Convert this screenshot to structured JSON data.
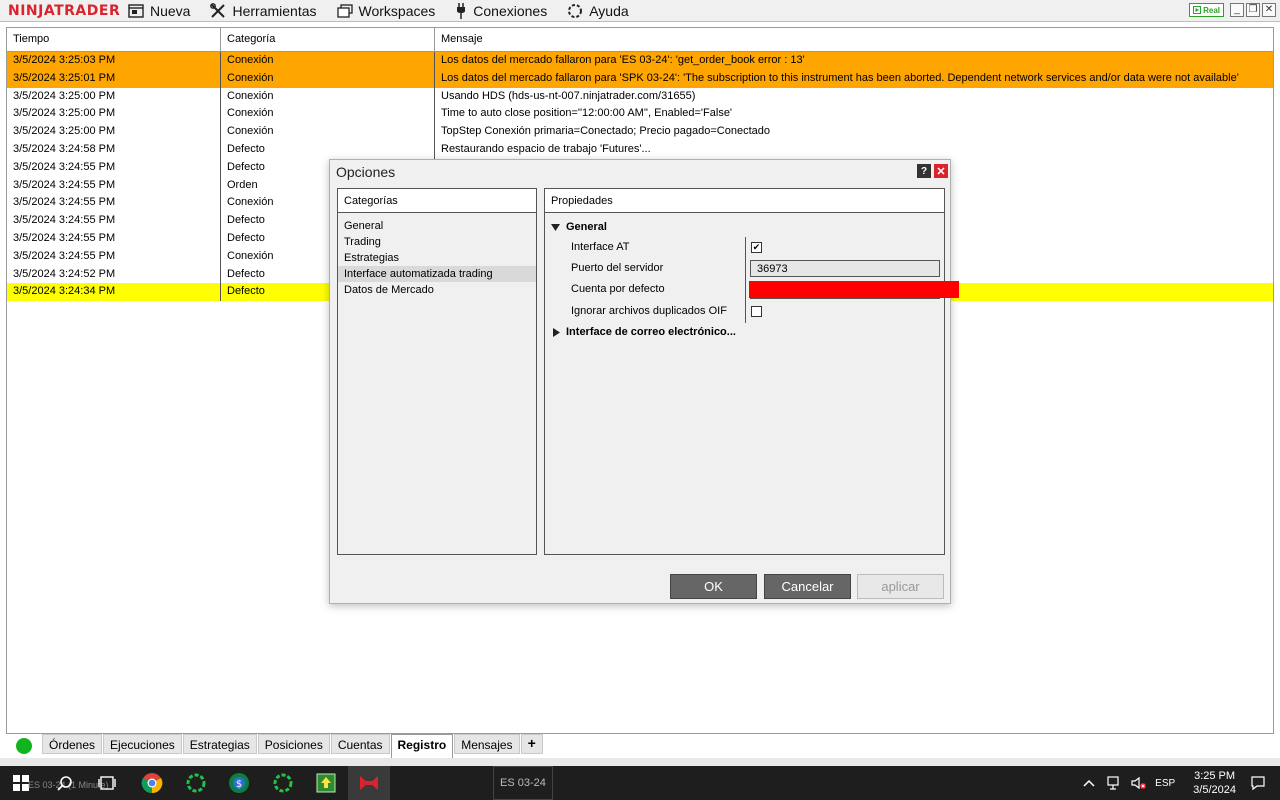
{
  "app": {
    "logo": "NINJATRADER",
    "menu": [
      {
        "label": "Nueva",
        "icon": "document-icon"
      },
      {
        "label": "Herramientas",
        "icon": "tools-icon"
      },
      {
        "label": "Workspaces",
        "icon": "windows-icon"
      },
      {
        "label": "Conexiones",
        "icon": "plug-icon"
      },
      {
        "label": "Ayuda",
        "icon": "help-ring-icon"
      }
    ],
    "badge": "Real",
    "accent_color": "#d9232d"
  },
  "log": {
    "columns": [
      "Tiempo",
      "Categoría",
      "Mensaje"
    ],
    "rows": [
      {
        "time": "3/5/2024 3:25:03 PM",
        "category": "Conexión",
        "message": "Los datos del mercado fallaron para 'ES 03-24': 'get_order_book error : 13'",
        "highlight": "orange"
      },
      {
        "time": "3/5/2024 3:25:01 PM",
        "category": "Conexión",
        "message": "Los datos del mercado fallaron para 'SPK 03-24': 'The subscription to this instrument has been aborted.  Dependent network services and/or data were not available'",
        "highlight": "orange"
      },
      {
        "time": "3/5/2024 3:25:00 PM",
        "category": "Conexión",
        "message": "Usando HDS (hds-us-nt-007.ninjatrader.com/31655)",
        "highlight": ""
      },
      {
        "time": "3/5/2024 3:25:00 PM",
        "category": "Conexión",
        "message": "Time to auto close position=''12:00:00 AM'', Enabled='False'",
        "highlight": ""
      },
      {
        "time": "3/5/2024 3:25:00 PM",
        "category": "Conexión",
        "message": "TopStep Conexión primaria=Conectado; Precio pagado=Conectado",
        "highlight": ""
      },
      {
        "time": "3/5/2024 3:24:58 PM",
        "category": "Defecto",
        "message": "Restaurando espacio de trabajo 'Futures'...",
        "highlight": ""
      },
      {
        "time": "3/5/2024 3:24:55 PM",
        "category": "Defecto",
        "message": "",
        "highlight": ""
      },
      {
        "time": "3/5/2024 3:24:55 PM",
        "category": "Orden",
        "message": "",
        "highlight": ""
      },
      {
        "time": "3/5/2024 3:24:55 PM",
        "category": "Conexión",
        "message": "",
        "highlight": ""
      },
      {
        "time": "3/5/2024 3:24:55 PM",
        "category": "Defecto",
        "message": "",
        "highlight": ""
      },
      {
        "time": "3/5/2024 3:24:55 PM",
        "category": "Defecto",
        "message": "",
        "highlight": ""
      },
      {
        "time": "3/5/2024 3:24:55 PM",
        "category": "Conexión",
        "message": "",
        "highlight": ""
      },
      {
        "time": "3/5/2024 3:24:52 PM",
        "category": "Defecto",
        "message": "",
        "highlight": ""
      },
      {
        "time": "3/5/2024 3:24:34 PM",
        "category": "Defecto",
        "message": "",
        "highlight": "yellow"
      }
    ]
  },
  "tabs": {
    "items": [
      "Órdenes",
      "Ejecuciones",
      "Estrategias",
      "Posiciones",
      "Cuentas",
      "Registro",
      "Mensajes"
    ],
    "active": "Registro",
    "add": "+"
  },
  "dialog": {
    "title": "Opciones",
    "help": "?",
    "close": "✕",
    "categories_header": "Categorías",
    "categories": [
      "General",
      "Trading",
      "Estrategias",
      "Interface automatizada trading",
      "Datos de Mercado"
    ],
    "selected_category": "Interface automatizada trading",
    "properties_header": "Propiedades",
    "section_general": "General",
    "props": {
      "interface_at_label": "Interface AT",
      "interface_at_checked": true,
      "port_label": "Puerto del servidor",
      "port_value": "36973",
      "account_label": "Cuenta por defecto",
      "ignore_label": "Ignorar archivos duplicados OIF",
      "ignore_checked": false
    },
    "section_email": "Interface de correo electrónico...",
    "buttons": {
      "ok": "OK",
      "cancel": "Cancelar",
      "apply": "aplicar"
    }
  },
  "taskbar": {
    "behind_label": "ES 03-24 (1 Minute)",
    "behind_tab": "ES 03-24",
    "lang": "ESP",
    "time": "3:25 PM",
    "date": "3/5/2024"
  }
}
